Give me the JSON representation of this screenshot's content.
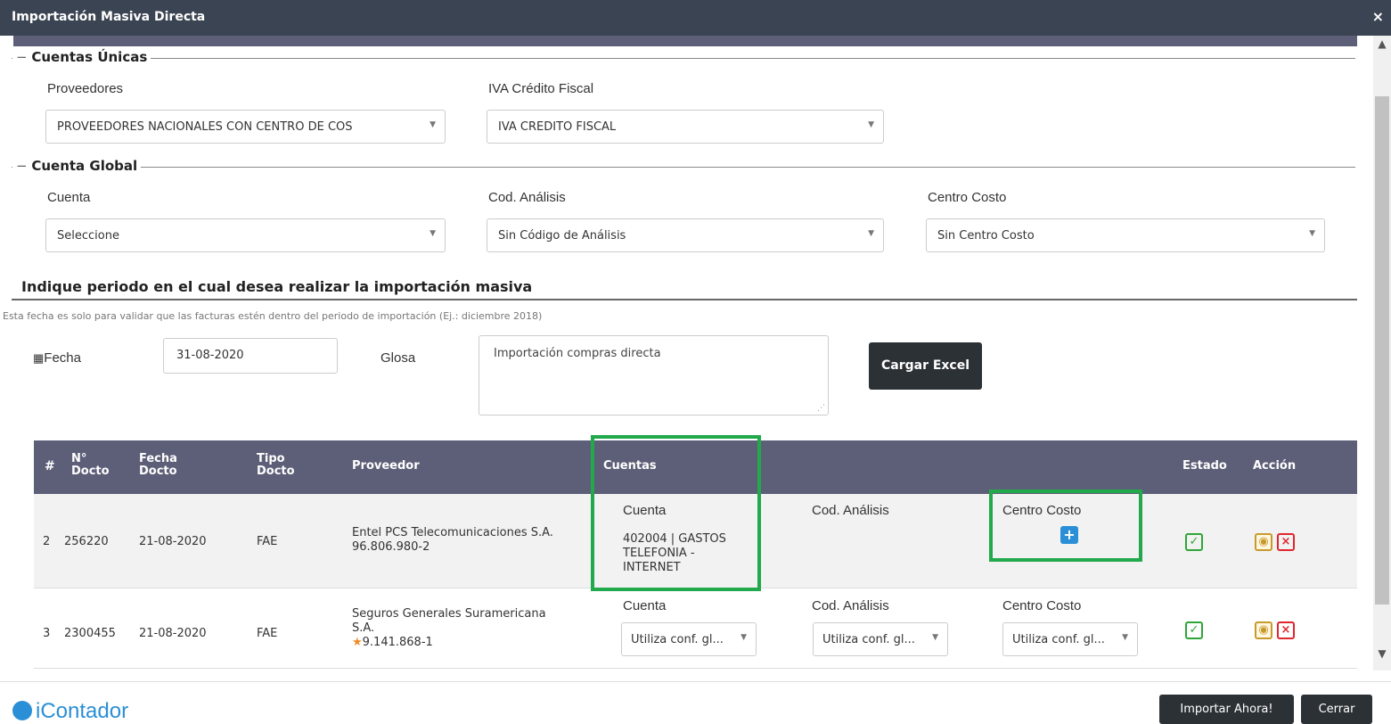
{
  "dialog": {
    "title": "Importación Masiva Directa",
    "close_icon": "×"
  },
  "unique_accounts": {
    "legend": "Cuentas Únicas",
    "proveedores_label": "Proveedores",
    "proveedores_value": "PROVEEDORES NACIONALES CON CENTRO DE COS",
    "iva_label": "IVA Crédito Fiscal",
    "iva_value": "IVA CREDITO FISCAL"
  },
  "global_account": {
    "legend": "Cuenta Global",
    "cuenta_label": "Cuenta",
    "cuenta_value": "Seleccione",
    "analisis_label": "Cod. Análisis",
    "analisis_value": "Sin Código de Análisis",
    "centro_label": "Centro Costo",
    "centro_value": "Sin Centro Costo"
  },
  "period": {
    "title": "Indique periodo en el cual desea realizar la importación masiva",
    "hint": "Esta fecha es solo para validar que las facturas estén dentro del periodo de importación (Ej.: diciembre 2018)",
    "fecha_label": "Fecha",
    "fecha_value": "31-08-2020",
    "glosa_label": "Glosa",
    "glosa_value": "Importación compras directa",
    "load_button": "Cargar Excel"
  },
  "table": {
    "headers": {
      "num": "#",
      "docto_1": "N°",
      "docto_2": "Docto",
      "fecha_1": "Fecha",
      "fecha_2": "Docto",
      "tipo_1": "Tipo",
      "tipo_2": "Docto",
      "proveedor": "Proveedor",
      "cuentas": "Cuentas",
      "estado": "Estado",
      "accion": "Acción"
    },
    "rows": [
      {
        "num": "2",
        "docto": "256220",
        "fecha": "21-08-2020",
        "tipo": "FAE",
        "proveedor_name": "Entel PCS Telecomunicaciones S.A.",
        "proveedor_rut": "96.806.980-2",
        "cuenta_label": "Cuenta",
        "cuenta_value_1": "402004 | GASTOS",
        "cuenta_value_2": "TELEFONIA -",
        "cuenta_value_3": "INTERNET",
        "analisis_label": "Cod. Análisis",
        "centro_label": "Centro Costo"
      },
      {
        "num": "3",
        "docto": "2300455",
        "fecha": "21-08-2020",
        "tipo": "FAE",
        "proveedor_name_1": "Seguros Generales Suramericana",
        "proveedor_name_2": "S.A.",
        "proveedor_rut": "9.141.868-1",
        "cuenta_label": "Cuenta",
        "cuenta_select": "Utiliza conf. gl...",
        "analisis_label": "Cod. Análisis",
        "analisis_select": "Utiliza conf. gl...",
        "centro_label": "Centro Costo",
        "centro_select": "Utiliza conf. gl..."
      }
    ]
  },
  "footer": {
    "logo_text": "iContador",
    "import_button": "Importar Ahora!",
    "close_button": "Cerrar"
  },
  "colors": {
    "titlebar": "#3b4452",
    "grid_header": "#5d5f78",
    "highlight": "#22a94b",
    "brand": "#2a8fd6"
  }
}
